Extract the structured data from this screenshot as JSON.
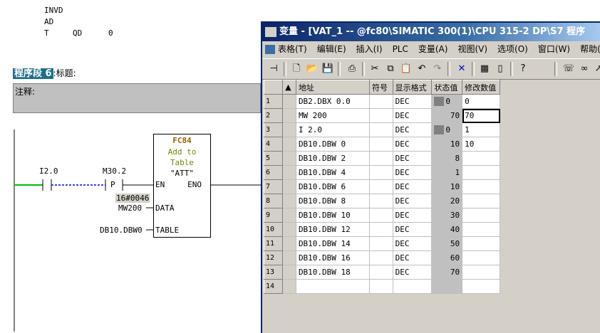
{
  "lad": {
    "stmt_lines": [
      "INVD",
      "AD",
      "T",
      "QD",
      "0"
    ],
    "network_label": "程序段 6",
    "network_suffix": ":标题:",
    "comment_label": "注释:",
    "contact_i20": "I2.0",
    "contact_m302": "M30.2",
    "pcoil_label": "P",
    "fc_name": "FC84",
    "fc_desc_1": "Add to",
    "fc_desc_2": "Table",
    "fc_desc_3": "\"ATT\"",
    "pin_en": "EN",
    "pin_eno": "ENO",
    "pin_data": "DATA",
    "pin_table": "TABLE",
    "data_value": "16#0046",
    "data_operand": "MW200",
    "table_operand": "DB10.DBW0"
  },
  "vat": {
    "title": "变量 - [VAT_1 -- @fc80\\SIMATIC 300(1)\\CPU 315-2 DP\\S7 程序",
    "menu": [
      "表格(T)",
      "编辑(E)",
      "插入(I)",
      "PLC",
      "变量(A)",
      "视图(V)",
      "选项(O)",
      "窗口(W)",
      "帮助(H)"
    ],
    "columns": [
      "地址",
      "符号",
      "显示格式",
      "状态值",
      "修改数值"
    ],
    "rows": [
      {
        "n": "1",
        "addr": "DB2.DBX    0.0",
        "fmt": "DEC",
        "status": "0",
        "status_box": true,
        "mod": "0"
      },
      {
        "n": "2",
        "addr": "MW   200",
        "fmt": "DEC",
        "status": "70",
        "status_box": false,
        "mod": "70",
        "active": true
      },
      {
        "n": "3",
        "addr": "I     2.0",
        "fmt": "DEC",
        "status": "0",
        "status_box": true,
        "mod": "1"
      },
      {
        "n": "4",
        "addr": "DB10.DBW    0",
        "fmt": "DEC",
        "status": "10",
        "status_box": false,
        "mod": "10"
      },
      {
        "n": "5",
        "addr": "DB10.DBW    2",
        "fmt": "DEC",
        "status": "8",
        "status_box": false,
        "mod": ""
      },
      {
        "n": "6",
        "addr": "DB10.DBW    4",
        "fmt": "DEC",
        "status": "1",
        "status_box": false,
        "mod": ""
      },
      {
        "n": "7",
        "addr": "DB10.DBW    6",
        "fmt": "DEC",
        "status": "10",
        "status_box": false,
        "mod": ""
      },
      {
        "n": "8",
        "addr": "DB10.DBW    8",
        "fmt": "DEC",
        "status": "20",
        "status_box": false,
        "mod": ""
      },
      {
        "n": "9",
        "addr": "DB10.DBW   10",
        "fmt": "DEC",
        "status": "30",
        "status_box": false,
        "mod": ""
      },
      {
        "n": "10",
        "addr": "DB10.DBW   12",
        "fmt": "DEC",
        "status": "40",
        "status_box": false,
        "mod": ""
      },
      {
        "n": "11",
        "addr": "DB10.DBW   14",
        "fmt": "DEC",
        "status": "50",
        "status_box": false,
        "mod": ""
      },
      {
        "n": "12",
        "addr": "DB10.DBW   16",
        "fmt": "DEC",
        "status": "60",
        "status_box": false,
        "mod": ""
      },
      {
        "n": "13",
        "addr": "DB10.DBW   18",
        "fmt": "DEC",
        "status": "70",
        "status_box": false,
        "mod": ""
      },
      {
        "n": "14",
        "addr": "",
        "fmt": "",
        "status": "",
        "status_box": false,
        "mod": ""
      }
    ]
  },
  "colors": {
    "title_bar": "#0a246a",
    "network_label_bg": "#1f6f8b",
    "rung_active": "#00c000",
    "rung_inactive": "#0000ff",
    "fc_name": "#a06000",
    "fc_desc": "#6a8a00"
  }
}
